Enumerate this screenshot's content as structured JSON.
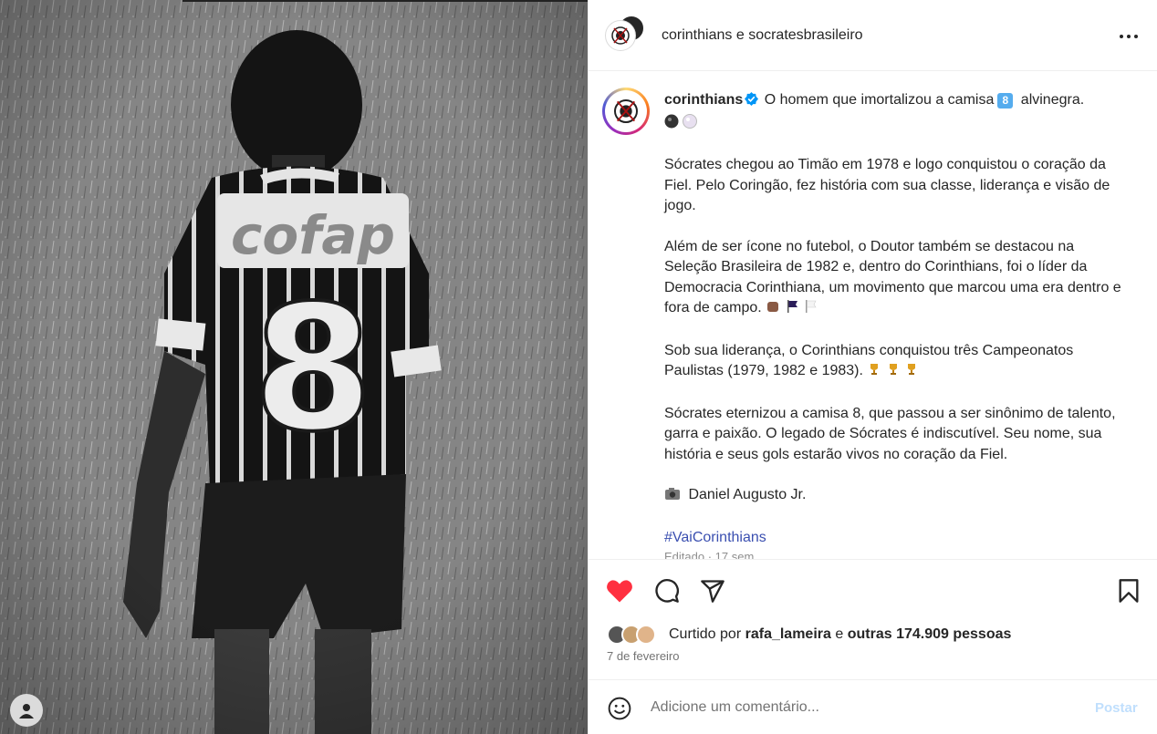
{
  "header": {
    "title_user": "corinthians",
    "title_sep": "e",
    "title_collab": "socratesbrasileiro",
    "more_icon": "more-horizontal-icon"
  },
  "caption": {
    "username": "corinthians",
    "line1_text": "O homem que imortalizou a camisa",
    "line1_num": "8",
    "line1_end": "alvinegra.",
    "p1": "Sócrates chegou ao Timão em 1978 e logo conquistou o coração da Fiel. Pelo Coringão, fez história com sua classe, liderança e visão de jogo.",
    "p2": "Além de ser ícone no futebol, o Doutor também se destacou na Seleção Brasileira de 1982 e, dentro do Corinthians, foi o líder da Democracia Corinthiana, um movimento que marcou uma era dentro e fora de campo.",
    "p3": "Sob sua liderança, o Corinthians conquistou três Campeonatos Paulistas (1979, 1982 e 1983).",
    "p4": "Sócrates eternizou a camisa 8, que passou a ser sinônimo de talento, garra e paixão. O legado de Sócrates é indiscutível. Seu nome, sua história e seus gols estarão vivos no coração da Fiel.",
    "photo_credit": "Daniel Augusto Jr.",
    "hashtag": "#VaiCorinthians",
    "edited": "Editado · 17 sem"
  },
  "actions": {
    "like_icon": "heart-filled-icon",
    "comment_icon": "comment-icon",
    "share_icon": "send-icon",
    "save_icon": "bookmark-icon",
    "liked_by_prefix": "Curtido por",
    "liked_by_user": "rafa_lameira",
    "liked_by_and": "e",
    "liked_by_others": "outras 174.909 pessoas",
    "date": "7 de fevereiro"
  },
  "comment": {
    "placeholder": "Adicione um comentário...",
    "post_label": "Postar"
  },
  "colors": {
    "like_red": "#ff3040",
    "verified_blue": "#0095f6",
    "post_disabled": "#c0dffd",
    "hashtag": "#3a4fb0"
  }
}
